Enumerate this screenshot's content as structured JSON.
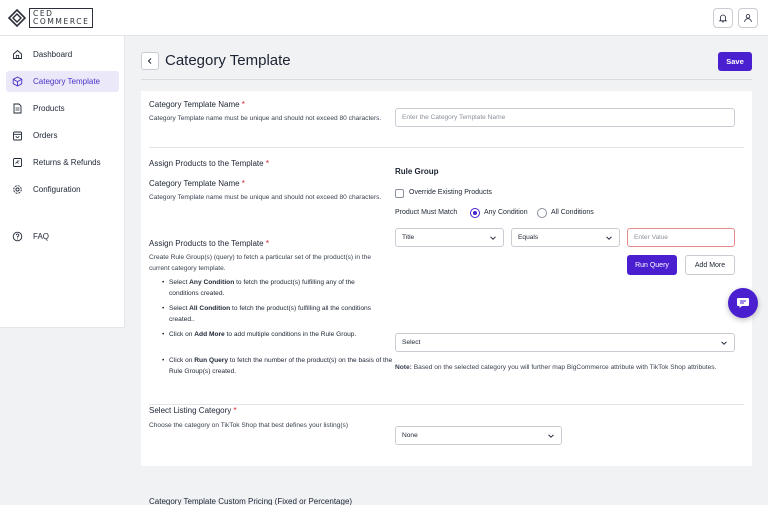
{
  "brand": {
    "line1": "CED",
    "line2": "COMMERCE"
  },
  "sidebar": {
    "items": [
      {
        "label": "Dashboard",
        "icon": "home-icon"
      },
      {
        "label": "Category Template",
        "icon": "cube-icon",
        "active": true
      },
      {
        "label": "Products",
        "icon": "document-icon"
      },
      {
        "label": "Orders",
        "icon": "shopping-bag-icon"
      },
      {
        "label": "Returns & Refunds",
        "icon": "return-icon"
      },
      {
        "label": "Configuration",
        "icon": "gear-icon"
      },
      {
        "label": "FAQ",
        "icon": "help-circle-icon"
      }
    ]
  },
  "header": {
    "title": "Category Template",
    "save_label": "Save"
  },
  "name_section": {
    "label": "Category Template Name",
    "required": "*",
    "help": "Category Template name must be unique and should not exceed 80 characters.",
    "placeholder": "Enter the Category Template Name"
  },
  "assign_section": {
    "label": "Assign Products to the Template",
    "required": "*",
    "dup_label": "Category Template Name",
    "dup_help": "Category Template name must be unique and should not exceed 80 characters.",
    "dup_assign_label": "Assign Products to the Template",
    "intro": "Create Rule Group(s) (query) to fetch a particular set of the product(s) in the current category template.",
    "bullets": [
      {
        "prefix": "Select ",
        "bold": "Any Condition",
        "suffix": " to fetch the product(s) fulfilling any of the conditions created."
      },
      {
        "prefix": "Select ",
        "bold": "All Condition",
        "suffix": " to fetch the product(s) fulfilling all the conditions created.."
      },
      {
        "prefix": "Click on ",
        "bold": "Add More",
        "suffix": " to add multiple conditions in the Rule Group."
      },
      {
        "prefix": "Click on ",
        "bold": "Run Query",
        "suffix": " to fetch the number of the product(s) on the basis of the Rule Group(s) created."
      }
    ]
  },
  "rule_group": {
    "title": "Rule Group",
    "override_label": "Override Existing Products",
    "match_label": "Product Must Match",
    "any_condition": "Any Condition",
    "all_conditions": "All Conditions",
    "field_select": "Title",
    "operator_select": "Equals",
    "value_placeholder": "Enter Value",
    "run_query": "Run Query",
    "add_more": "Add More"
  },
  "category_select": {
    "value": "Select",
    "note_bold": "Note:",
    "note": " Based on the selected category you will further map BigCommerce attribute with TikTok Shop attributes."
  },
  "listing_section": {
    "label": "Select Listing Category",
    "required": "*",
    "help": "Choose the category on TikTok Shop that best defines your listing(s)",
    "value": "None"
  },
  "pricing_section": {
    "label": "Category Template Custom Pricing (Fixed or Percentage)"
  },
  "colors": {
    "accent": "#4a1fd0",
    "required": "#d4202a",
    "active_bg": "#ebe9f9"
  }
}
